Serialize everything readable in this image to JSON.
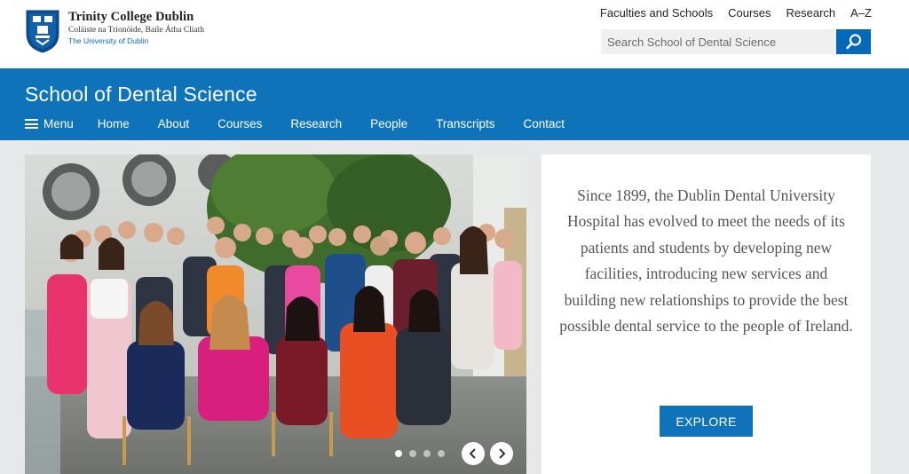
{
  "header": {
    "logo_name": "Trinity College Dublin",
    "logo_irish": "Coláiste na Tríonóide, Baile Átha Cliath",
    "logo_sub": "The University of Dublin",
    "top_links": [
      "Faculties and Schools",
      "Courses",
      "Research",
      "A–Z"
    ],
    "search_placeholder": "Search School of Dental Science",
    "search_icon": "search-icon"
  },
  "banner": {
    "title": "School of Dental Science",
    "menu_label": "Menu",
    "nav": [
      "Home",
      "About",
      "Courses",
      "Research",
      "People",
      "Transcripts",
      "Contact"
    ]
  },
  "carousel": {
    "slide_count": 4,
    "active_slide": 1,
    "prev_icon": "chevron-left-icon",
    "next_icon": "chevron-right-icon"
  },
  "intro": {
    "text": "Since 1899, the Dublin Dental University Hospital has evolved to meet the needs of its patients and students by developing new facilities, introducing new services and building new relationships to provide the best possible dental service to the people of Ireland.",
    "button_label": "EXPLORE"
  },
  "colors": {
    "brand_blue": "#0e73b9",
    "search_blue": "#0569b9",
    "page_bg": "#e7e8ea"
  }
}
